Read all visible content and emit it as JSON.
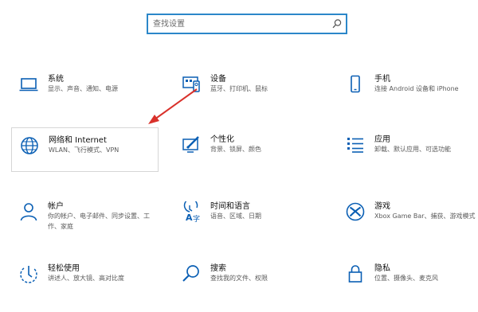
{
  "search": {
    "placeholder": "查找设置"
  },
  "accent": "#0a5fb4",
  "arrow_color": "#d9312b",
  "tiles": [
    {
      "icon": "laptop-icon",
      "title": "系统",
      "desc": "显示、声音、通知、电源"
    },
    {
      "icon": "devices-icon",
      "title": "设备",
      "desc": "蓝牙、打印机、鼠标"
    },
    {
      "icon": "phone-icon",
      "title": "手机",
      "desc": "连接 Android 设备和 iPhone"
    },
    {
      "icon": "globe-icon",
      "title": "网络和 Internet",
      "desc": "WLAN、飞行模式、VPN"
    },
    {
      "icon": "personalization-icon",
      "title": "个性化",
      "desc": "背景、锁屏、颜色"
    },
    {
      "icon": "apps-icon",
      "title": "应用",
      "desc": "卸载、默认应用、可选功能"
    },
    {
      "icon": "user-icon",
      "title": "帐户",
      "desc": "你的帐户、电子邮件、同步设置、工作、家庭"
    },
    {
      "icon": "time-language-icon",
      "title": "时间和语言",
      "desc": "语音、区域、日期"
    },
    {
      "icon": "xbox-icon",
      "title": "游戏",
      "desc": "Xbox Game Bar、捕获、游戏模式"
    },
    {
      "icon": "ease-of-access-icon",
      "title": "轻松使用",
      "desc": "讲述人、放大镜、高对比度"
    },
    {
      "icon": "search-icon",
      "title": "搜索",
      "desc": "查找我的文件、权限"
    },
    {
      "icon": "lock-icon",
      "title": "隐私",
      "desc": "位置、摄像头、麦克风"
    }
  ]
}
